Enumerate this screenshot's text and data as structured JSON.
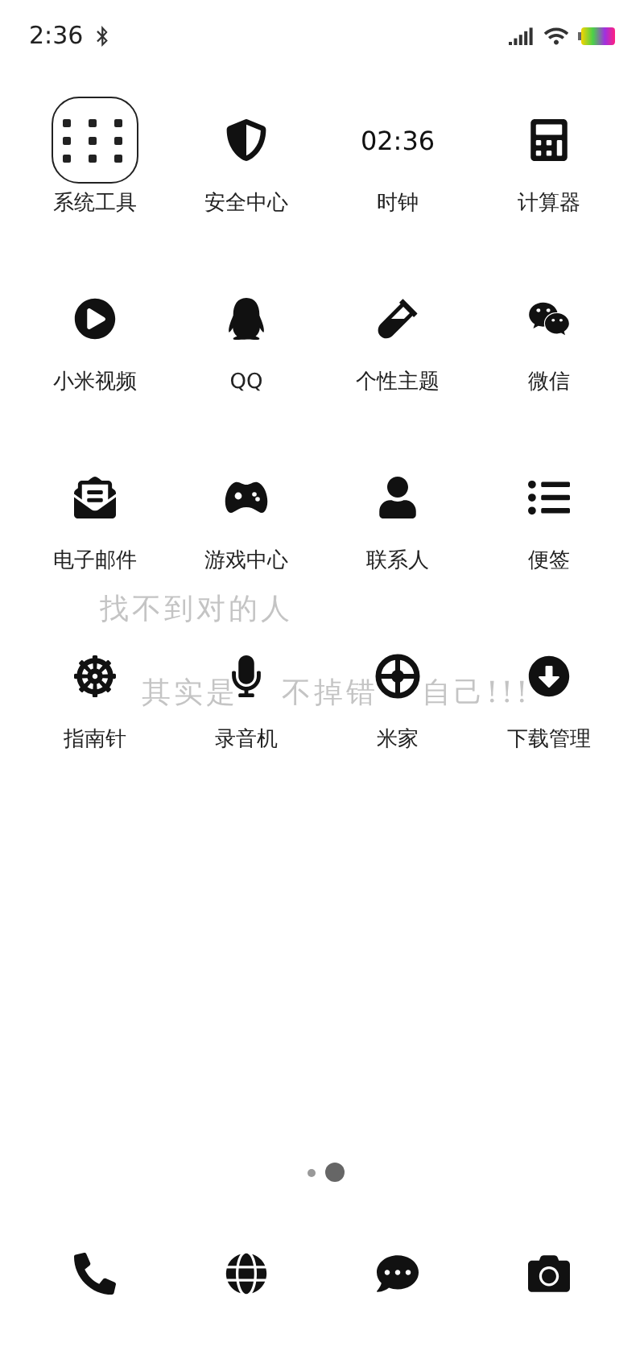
{
  "status_bar": {
    "time": "2:36"
  },
  "clock_widget": {
    "time": "02:36"
  },
  "apps": [
    {
      "label": "系统工具"
    },
    {
      "label": "安全中心"
    },
    {
      "label": "时钟"
    },
    {
      "label": "计算器"
    },
    {
      "label": "小米视频"
    },
    {
      "label": "QQ"
    },
    {
      "label": "个性主题"
    },
    {
      "label": "微信"
    },
    {
      "label": "电子邮件"
    },
    {
      "label": "游戏中心"
    },
    {
      "label": "联系人"
    },
    {
      "label": "便签"
    },
    {
      "label": "指南针"
    },
    {
      "label": "录音机"
    },
    {
      "label": "米家"
    },
    {
      "label": "下载管理"
    }
  ],
  "wallpaper_text": [
    "找不到对的人",
    "其实是",
    "不掉错",
    "自己!!!"
  ],
  "page_indicator": [
    {
      "selected": false
    },
    {
      "selected": true
    }
  ]
}
